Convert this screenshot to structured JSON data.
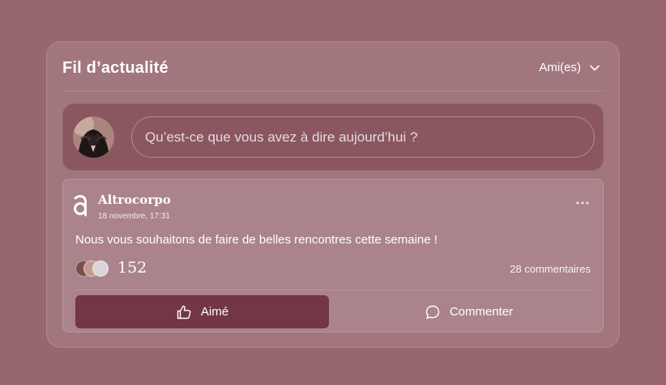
{
  "feed": {
    "title": "Fil d’actualité",
    "filter_label": "Ami(es)"
  },
  "composer": {
    "placeholder": "Qu’est-ce que vous avez à dire aujourd’hui ?"
  },
  "post": {
    "author": "Altrocorpo",
    "date": "18 novembre, 17:31",
    "text": "Nous vous souhaitons de faire de belles rencontres cette semaine !",
    "likes": "152",
    "comments": "28 commentaires"
  },
  "actions": {
    "like_label": "Aimé",
    "comment_label": "Commenter"
  },
  "colors": {
    "background": "#97676f",
    "composer_bg": "#8a5660",
    "liked_button": "#733645"
  },
  "icons": [
    "chevron-down-icon",
    "more-options-icon",
    "thumbs-up-icon",
    "comment-bubble-icon"
  ]
}
